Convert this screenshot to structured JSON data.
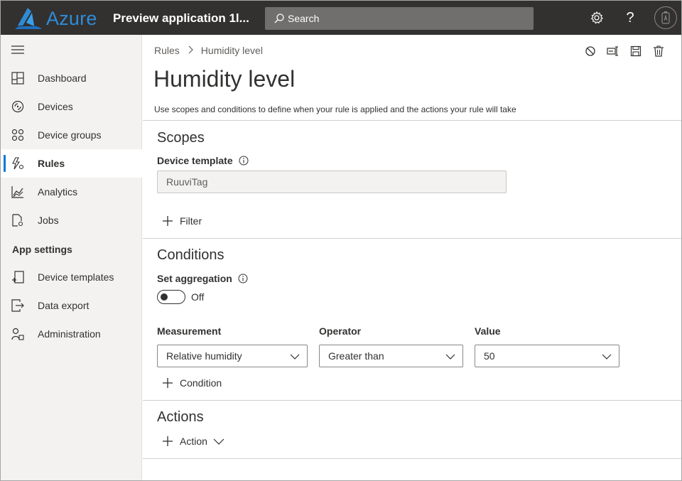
{
  "header": {
    "brand": "Azure",
    "app_title": "Preview application 1l...",
    "search_placeholder": "Search"
  },
  "sidebar": {
    "items": [
      {
        "label": "Dashboard",
        "icon": "dashboard-icon"
      },
      {
        "label": "Devices",
        "icon": "devices-icon"
      },
      {
        "label": "Device groups",
        "icon": "device-groups-icon"
      },
      {
        "label": "Rules",
        "icon": "rules-icon",
        "active": true
      },
      {
        "label": "Analytics",
        "icon": "analytics-icon"
      },
      {
        "label": "Jobs",
        "icon": "jobs-icon"
      }
    ],
    "section": "App settings",
    "settings_items": [
      {
        "label": "Device templates",
        "icon": "device-templates-icon"
      },
      {
        "label": "Data export",
        "icon": "data-export-icon"
      },
      {
        "label": "Administration",
        "icon": "administration-icon"
      }
    ]
  },
  "breadcrumb": {
    "parent": "Rules",
    "current": "Humidity level"
  },
  "page": {
    "title": "Humidity level",
    "description": "Use scopes and conditions to define when your rule is applied and the actions your rule will take"
  },
  "scopes": {
    "title": "Scopes",
    "device_template_label": "Device template",
    "device_template_value": "RuuviTag",
    "filter_label": "Filter"
  },
  "conditions": {
    "title": "Conditions",
    "aggregation_label": "Set aggregation",
    "aggregation_state": "Off",
    "measurement_label": "Measurement",
    "measurement_value": "Relative humidity",
    "operator_label": "Operator",
    "operator_value": "Greater than",
    "value_label": "Value",
    "value_value": "50",
    "add_condition_label": "Condition"
  },
  "actions": {
    "title": "Actions",
    "add_action_label": "Action"
  },
  "colors": {
    "topbar": "#323130",
    "accent": "#0078d4",
    "sidebar_bg": "#f3f2f1"
  }
}
